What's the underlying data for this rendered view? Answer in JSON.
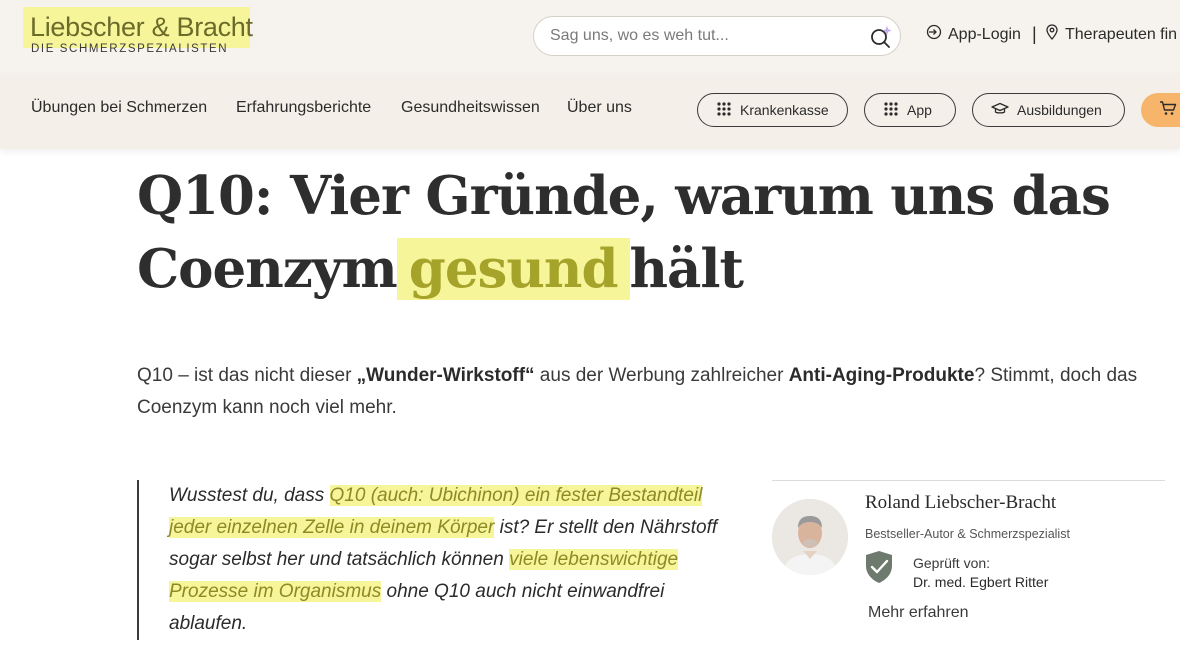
{
  "header": {
    "logo_title": "Liebscher & Bracht",
    "logo_subtitle": "DIE SCHMERZSPEZIALISTEN",
    "search_placeholder": "Sag uns, wo es weh tut...",
    "app_login": "App-Login",
    "separator": "|",
    "therapist": "Therapeuten fin"
  },
  "nav": {
    "links": [
      "Übungen bei Schmerzen",
      "Erfahrungsberichte",
      "Gesundheitswissen",
      "Über uns"
    ],
    "pills": [
      "Krankenkasse",
      "App",
      "Ausbildungen"
    ]
  },
  "article": {
    "title_part1": "Q10: Vier Gründe, warum uns das Coenzym",
    "title_highlight": "gesund",
    "title_part2": "hält",
    "intro_1": "Q10 – ist das nicht dieser ",
    "intro_bold1": "„Wunder-Wirkstoff“",
    "intro_2": " aus der Werbung zahlreicher ",
    "intro_bold2": "Anti-Aging-Produkte",
    "intro_3": "? Stimmt, doch das Coenzym kann noch viel mehr.",
    "quote_1": "Wusstest du, dass ",
    "quote_hl1": "Q10 (auch: Ubichinon) ein fester Bestandteil jeder einzelnen Zelle in deinem Körper",
    "quote_2": " ist? Er stellt den Nährstoff sogar selbst her und tatsächlich können ",
    "quote_hl2": "viele lebenswichtige Prozesse im Organismus",
    "quote_3": " ohne Q10 auch nicht einwandfrei ablaufen."
  },
  "author": {
    "name": "Roland Liebscher-Bracht",
    "role": "Bestseller-Autor & Schmerzspezialist",
    "checked_label": "Geprüft von:",
    "checked_by": "Dr. med. Egbert Ritter",
    "more": "Mehr erfahren"
  },
  "colors": {
    "highlight": "#f7f59a",
    "topbar_bg": "#f6f3ee",
    "navbar_bg": "#f4efe8",
    "cart_pill": "#f7b56b",
    "shield": "#6f7a6f"
  }
}
